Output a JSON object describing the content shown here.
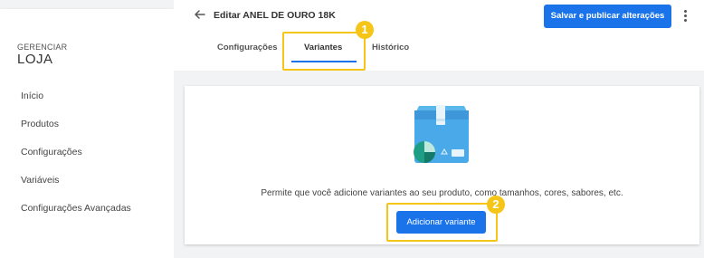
{
  "sidebar": {
    "store_label_small": "GERENCIAR",
    "store_label_big": "LOJA",
    "items": [
      {
        "label": "Início"
      },
      {
        "label": "Produtos"
      },
      {
        "label": "Configurações"
      },
      {
        "label": "Variáveis"
      },
      {
        "label": "Configurações Avançadas"
      }
    ]
  },
  "header": {
    "back_icon": "arrow-left-icon",
    "title": "Editar ANEL DE OURO 18K",
    "save_button": "Salvar e publicar alterações",
    "more_icon": "more-vertical-icon",
    "tabs": [
      {
        "label": "Configurações",
        "active": false
      },
      {
        "label": "Variantes",
        "active": true
      },
      {
        "label": "Histórico",
        "active": false
      }
    ]
  },
  "annotations": {
    "step1": "1",
    "step2": "2",
    "highlight_color": "#f5c518"
  },
  "main": {
    "illustration_icon": "package-box-icon",
    "description": "Permite que você adicione variantes ao seu produto, como tamanhos, cores, sabores, etc.",
    "add_variant_button": "Adicionar variante"
  },
  "colors": {
    "accent": "#1a73e8",
    "background": "#f1f3f4"
  }
}
